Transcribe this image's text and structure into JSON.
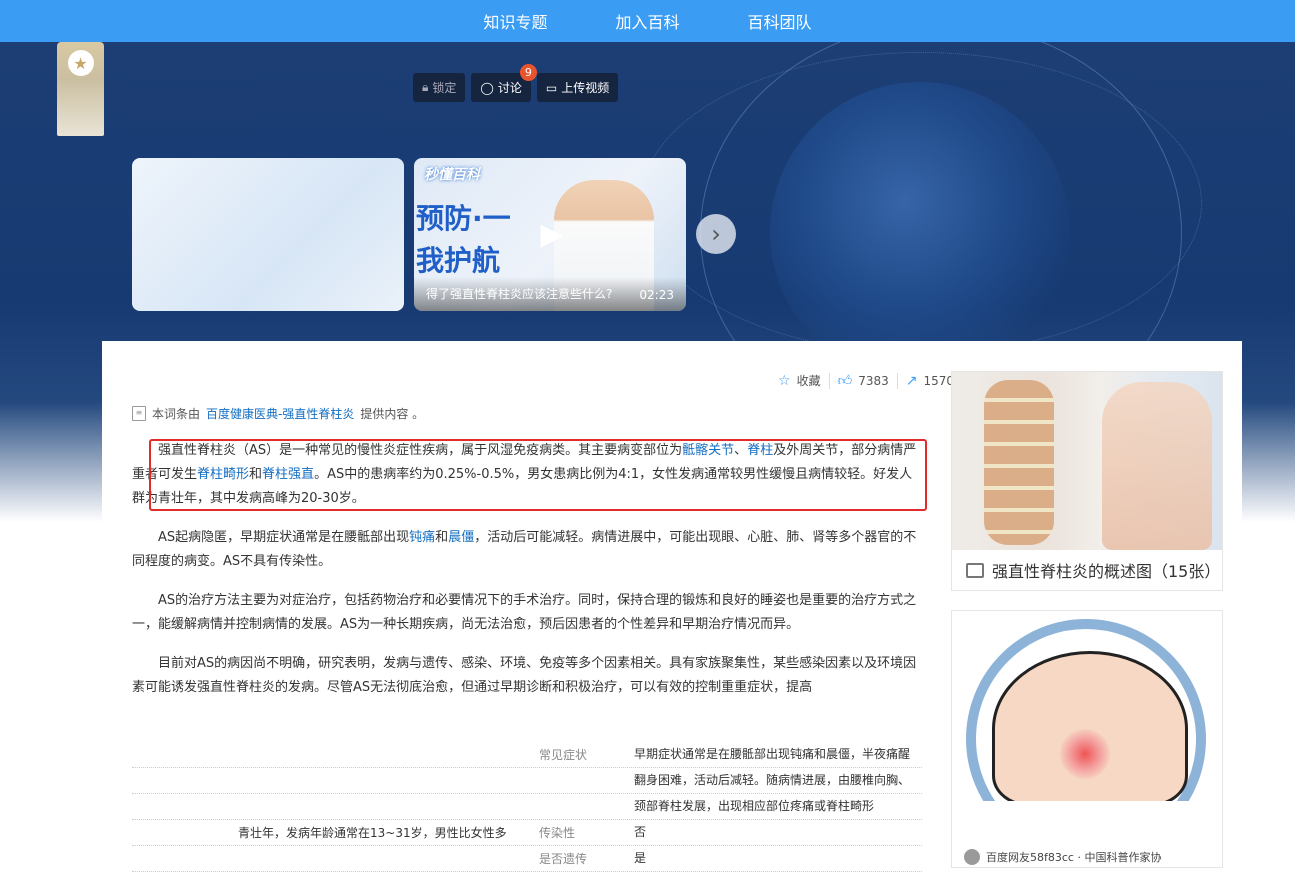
{
  "nav": {
    "items": [
      "知识专题",
      "加入百科",
      "百科团队"
    ]
  },
  "actions": {
    "lock": "锁定",
    "discuss": "讨论",
    "discuss_count": "9",
    "upload_video": "上传视频"
  },
  "videos": {
    "logo": "秒懂百科",
    "slogan_line1": "预防·一",
    "slogan_line2": "我护航",
    "caption": "得了强直性脊柱炎应该注意些什么?",
    "duration": "02:23"
  },
  "stats": {
    "favorite_label": "收藏",
    "likes": "7383",
    "shares": "1570"
  },
  "source": {
    "prefix": "本词条由",
    "link": "百度健康医典-强直性脊柱炎",
    "suffix": "提供内容 。"
  },
  "article": {
    "p1": {
      "t1": "强直性脊柱炎（AS）是一种常见的慢性炎症性疾病，属于风湿免疫病类。其主要病变部位为",
      "l1": "骶髂关节",
      "t2": "、",
      "l2": "脊柱",
      "t3": "及外周关节，部分病情严重者可发生",
      "l3": "脊柱畸形",
      "t4": "和",
      "l4": "脊柱强直",
      "t5": "。AS中的患病率约为0.25%-0.5%，男女患病比例为4:1，女性发病通常较男性缓慢且病情较轻。好发人群为青壮年，其中发病高峰为20-30岁。"
    },
    "p2": {
      "t1": "AS起病隐匿，早期症状通常是在腰骶部出现",
      "l1": "钝痛",
      "t2": "和",
      "l2": "晨僵",
      "t3": "，活动后可能减轻。病情进展中，可能出现眼、心脏、肺、肾等多个器官的不同程度的病变。AS不具有传染性。"
    },
    "p3": "AS的治疗方法主要为对症治疗，包括药物治疗和必要情况下的手术治疗。同时，保持合理的锻炼和良好的睡姿也是重要的治疗方式之一，能缓解病情并控制病情的发展。AS为一种长期疾病，尚无法治愈，预后因患者的个性差异和早期治疗情况而异。",
    "p4": "目前对AS的病因尚不明确，研究表明，发病与遗传、感染、环境、免疫等多个因素相关。具有家族聚集性，某些感染因素以及环境因素可能诱发强直性脊柱炎的发病。尽管AS无法彻底治愈，但通过早期诊断和积极治疗，可以有效的控制重重症状，提高"
  },
  "infobox": {
    "rows": [
      {
        "left": "",
        "key": "常见症状",
        "val": "早期症状通常是在腰骶部出现钝痛和晨僵，半夜痛醒"
      },
      {
        "left": "",
        "key": "",
        "val": "翻身困难，活动后减轻。随病情进展，由腰椎向胸、"
      },
      {
        "left": "",
        "key": "",
        "val": "颈部脊柱发展，出现相应部位疼痛或脊柱畸形"
      },
      {
        "left": "青壮年，发病年龄通常在13~31岁，男性比女性多",
        "key": "传染性",
        "val": "否"
      },
      {
        "left": "",
        "key": "是否遗传",
        "val": "是"
      }
    ]
  },
  "sidebar": {
    "album_title": "强直性脊柱炎的概述图（15张）",
    "author": "百度网友58f83cc · 中国科普作家协"
  },
  "colors": {
    "brand": "#3b9cf3",
    "link": "#136ec2",
    "highlight_border": "#e22b2b"
  }
}
